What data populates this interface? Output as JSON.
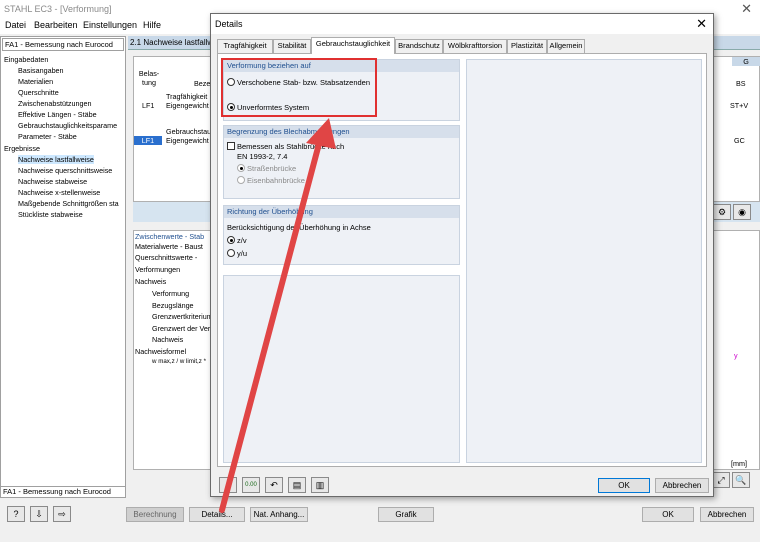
{
  "app": {
    "title": "STAHL EC3 - [Verformung]",
    "menu": [
      "Datei",
      "Bearbeiten",
      "Einstellungen",
      "Hilfe"
    ]
  },
  "sidebar": {
    "combo": "FA1 - Bemessung nach Eurocod",
    "items": [
      "Eingabedaten",
      "Basisangaben",
      "Materialien",
      "Querschnitte",
      "Zwischenabstützungen",
      "Effektive Längen - Stäbe",
      "Gebrauchstauglichkeitsparame",
      "Parameter - Stäbe",
      "Ergebnisse",
      "Nachweise lastfallweise",
      "Nachweise querschnittsweise",
      "Nachweise stabweise",
      "Nachweise x-stellenweise",
      "Maßgebende Schnittgrößen sta",
      "Stückliste stabweise"
    ],
    "bottom": "FA1 - Bemessung nach Eurocod"
  },
  "background": {
    "header": "2.1 Nachweise lastfallwe",
    "belastung": "Belas- tung",
    "col_bez": "Beze",
    "col_g": "G",
    "col_bs": "BS",
    "row1_group": "Tragfähigkeit",
    "row1_lf": "LF1",
    "row1_name": "Eigengewicht",
    "row1_bs": "ST+V",
    "row2_group": "Gebrauchstau",
    "row2_lf": "LF1",
    "row2_name": "Eigengewicht",
    "row2_gc": "GC",
    "lower_title": "Zwischenwerte - Stab",
    "lower_rows": [
      "Materialwerte - Baust",
      "Querschnittswerte  -",
      "Verformungen",
      "Nachweis",
      "Verformung",
      "Bezugslänge",
      "Grenzwertkriterium",
      "Grenzwert der Ver",
      "Nachweis",
      "Nachweisformel"
    ],
    "formula": "w max,z / w limit,z *",
    "unit": "[mm]",
    "axis": "y"
  },
  "bottom_buttons": {
    "berechnung": "Berechnung",
    "details": "Details...",
    "nat_anhang": "Nat. Anhang...",
    "grafik": "Grafik",
    "ok": "OK",
    "abbrechen": "Abbrechen"
  },
  "dialog": {
    "title": "Details",
    "tabs": [
      "Tragfähigkeit",
      "Stabilität",
      "Gebrauchstauglichkeit",
      "Brandschutz",
      "Wölbkrafttorsion",
      "Plastizität",
      "Allgemein"
    ],
    "active_tab": "Gebrauchstauglichkeit",
    "group1": {
      "title": "Verformung beziehen auf",
      "opt1": "Verschobene Stab- bzw. Stabsatzenden",
      "opt2": "Unverformtes System"
    },
    "group2": {
      "title": "Begrenzung des Blechabmessungen",
      "check": "Bemessen als Stahlbrücke nach",
      "norm": "EN 1993-2, 7.4",
      "opt1": "Straßenbrücke",
      "opt2": "Eisenbahnbrücke"
    },
    "group3": {
      "title": "Richtung der Überhöhung",
      "desc": "Berücksichtigung der Überhöhung in Achse",
      "opt1": "z/v",
      "opt2": "y/u"
    },
    "ok": "OK",
    "cancel": "Abbrechen",
    "icon_value": "0.00"
  },
  "annotation_color": "#e03030"
}
